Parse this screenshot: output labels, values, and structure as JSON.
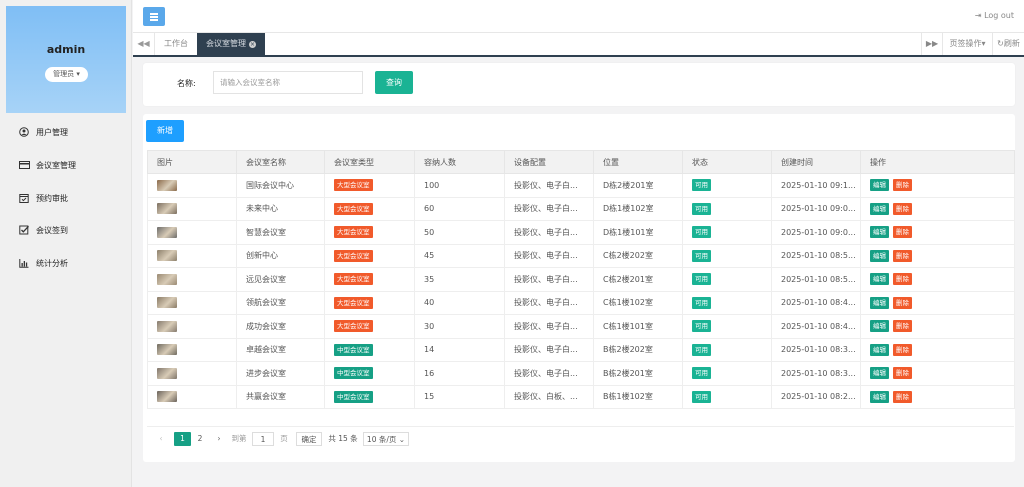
{
  "user": {
    "name": "admin",
    "role": "管理员"
  },
  "nav": [
    {
      "label": "用户管理",
      "icon": "user-circle-icon"
    },
    {
      "label": "会议室管理",
      "icon": "card-icon"
    },
    {
      "label": "预约审批",
      "icon": "calendar-check-icon"
    },
    {
      "label": "会议签到",
      "icon": "checkbox-icon"
    },
    {
      "label": "统计分析",
      "icon": "bar-chart-icon"
    }
  ],
  "header": {
    "logout": "Log out"
  },
  "tabs": {
    "items": [
      {
        "label": "工作台"
      },
      {
        "label": "会议室管理"
      }
    ],
    "page_ops": "页签操作",
    "refresh": "刷新"
  },
  "search": {
    "label": "名称:",
    "placeholder": "请输入会议室名称",
    "value": "",
    "button": "查询"
  },
  "add_button": "新增",
  "table": {
    "headers": [
      "图片",
      "会议室名称",
      "会议室类型",
      "容纳人数",
      "设备配置",
      "位置",
      "状态",
      "创建时间",
      "操作"
    ],
    "rows": [
      {
        "name": "国际会议中心",
        "type": "大型会议室",
        "capacity": "100",
        "equipment": "投影仪、电子白...",
        "location": "D栋2楼201室",
        "status": "可用",
        "created": "2025-01-10 09:1..."
      },
      {
        "name": "未来中心",
        "type": "大型会议室",
        "capacity": "60",
        "equipment": "投影仪、电子白...",
        "location": "D栋1楼102室",
        "status": "可用",
        "created": "2025-01-10 09:0..."
      },
      {
        "name": "智慧会议室",
        "type": "大型会议室",
        "capacity": "50",
        "equipment": "投影仪、电子白...",
        "location": "D栋1楼101室",
        "status": "可用",
        "created": "2025-01-10 09:0..."
      },
      {
        "name": "创新中心",
        "type": "大型会议室",
        "capacity": "45",
        "equipment": "投影仪、电子白...",
        "location": "C栋2楼202室",
        "status": "可用",
        "created": "2025-01-10 08:5..."
      },
      {
        "name": "远见会议室",
        "type": "大型会议室",
        "capacity": "35",
        "equipment": "投影仪、电子白...",
        "location": "C栋2楼201室",
        "status": "可用",
        "created": "2025-01-10 08:5..."
      },
      {
        "name": "领航会议室",
        "type": "大型会议室",
        "capacity": "40",
        "equipment": "投影仪、电子白...",
        "location": "C栋1楼102室",
        "status": "可用",
        "created": "2025-01-10 08:4..."
      },
      {
        "name": "成功会议室",
        "type": "大型会议室",
        "capacity": "30",
        "equipment": "投影仪、电子白...",
        "location": "C栋1楼101室",
        "status": "可用",
        "created": "2025-01-10 08:4..."
      },
      {
        "name": "卓越会议室",
        "type": "中型会议室",
        "capacity": "14",
        "equipment": "投影仪、电子白...",
        "location": "B栋2楼202室",
        "status": "可用",
        "created": "2025-01-10 08:3..."
      },
      {
        "name": "进步会议室",
        "type": "中型会议室",
        "capacity": "16",
        "equipment": "投影仪、电子白...",
        "location": "B栋2楼201室",
        "status": "可用",
        "created": "2025-01-10 08:3..."
      },
      {
        "name": "共赢会议室",
        "type": "中型会议室",
        "capacity": "15",
        "equipment": "投影仪、白板、...",
        "location": "B栋1楼102室",
        "status": "可用",
        "created": "2025-01-10 08:2..."
      }
    ],
    "edit_label": "编辑",
    "delete_label": "删除"
  },
  "pagination": {
    "pages": [
      "1",
      "2"
    ],
    "goto_label": "到第",
    "goto_value": "1",
    "page_suffix": "页",
    "confirm": "确定",
    "total": "共 15 条",
    "per_page": "10 条/页"
  },
  "colors": {
    "accent": "#1ab394",
    "primary": "#1e9fff",
    "danger": "#f15a2b",
    "sidebar_header": "#7fbef5",
    "tab_active": "#2f4050"
  }
}
